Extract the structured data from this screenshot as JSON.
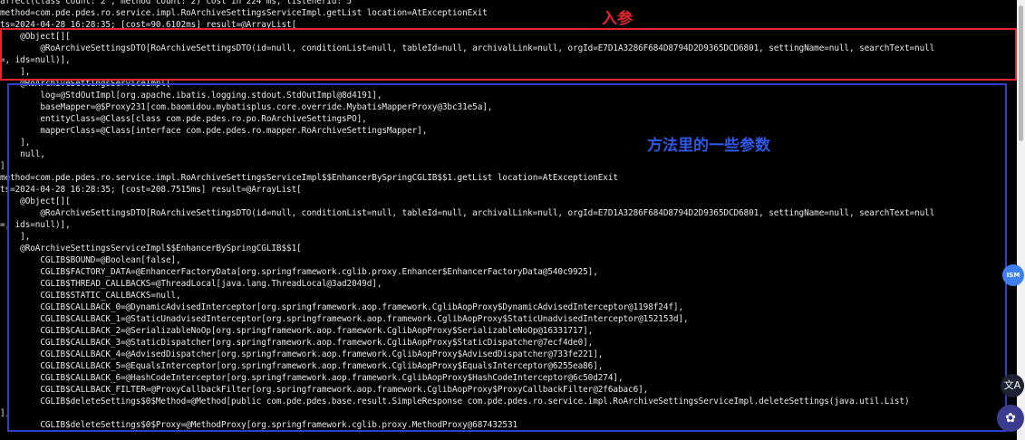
{
  "terminal": {
    "lines": [
      "affect(class count: 2 , method count: 2) cost in 224 ms, listenerId: 5",
      "method=com.pde.pdes.ro.service.impl.RoArchiveSettingsServiceImpl.getList location=AtExceptionExit",
      "ts=2024-04-28 16:28:35; [cost=90.6102ms] result=@ArrayList[",
      "    @Object[][",
      "        @RoArchiveSettingsDTO[RoArchiveSettingsDTO(id=null, conditionList=null, tableId=null, archivalLink=null, orgId=E7D1A3286F684D8794D2D9365DCD6801, settingName=null, searchText=null",
      "=, ids=null)],",
      "    ],",
      "    @RoArchiveSettingsServiceImpl[",
      "        log=@StdOutImpl[org.apache.ibatis.logging.stdout.StdOutImpl@8d4191],",
      "        baseMapper=@$Proxy231[com.baomidou.mybatisplus.core.override.MybatisMapperProxy@3bc31e5a],",
      "        entityClass=@Class[class com.pde.pdes.ro.po.RoArchiveSettingsPO],",
      "        mapperClass=@Class[interface com.pde.pdes.ro.mapper.RoArchiveSettingsMapper],",
      "    ],",
      "    null,",
      "]",
      "method=com.pde.pdes.ro.service.impl.RoArchiveSettingsServiceImpl$$EnhancerBySpringCGLIB$$1.getList location=AtExceptionExit",
      "ts=2024-04-28 16:28:35; [cost=208.7515ms] result=@ArrayList[",
      "    @Object[][",
      "        @RoArchiveSettingsDTO[RoArchiveSettingsDTO(id=null, conditionList=null, tableId=null, archivalLink=null, orgId=E7D1A3286F684D8794D2D9365DCD6801, settingName=null, searchText=null",
      "=, ids=null)],",
      "    ],",
      "    @RoArchiveSettingsServiceImpl$$EnhancerBySpringCGLIB$$1[",
      "        CGLIB$BOUND=@Boolean[false],",
      "        CGLIB$FACTORY_DATA=@EnhancerFactoryData[org.springframework.cglib.proxy.Enhancer$EnhancerFactoryData@540c9925],",
      "        CGLIB$THREAD_CALLBACKS=@ThreadLocal[java.lang.ThreadLocal@3ad2049d],",
      "        CGLIB$STATIC_CALLBACKS=null,",
      "        CGLIB$CALLBACK_0=@DynamicAdvisedInterceptor[org.springframework.aop.framework.CglibAopProxy$DynamicAdvisedInterceptor@1198f24f],",
      "        CGLIB$CALLBACK_1=@StaticUnadvisedInterceptor[org.springframework.aop.framework.CglibAopProxy$StaticUnadvisedInterceptor@152153d],",
      "        CGLIB$CALLBACK_2=@SerializableNoOp[org.springframework.aop.framework.CglibAopProxy$SerializableNoOp@16331717],",
      "        CGLIB$CALLBACK_3=@StaticDispatcher[org.springframework.aop.framework.CglibAopProxy$StaticDispatcher@7ecf4de0],",
      "        CGLIB$CALLBACK_4=@AdvisedDispatcher[org.springframework.aop.framework.CglibAopProxy$AdvisedDispatcher@733fe221],",
      "        CGLIB$CALLBACK_5=@EqualsInterceptor[org.springframework.aop.framework.CglibAopProxy$EqualsInterceptor@6255ea86],",
      "        CGLIB$CALLBACK_6=@HashCodeInterceptor[org.springframework.aop.framework.CglibAopProxy$HashCodeInterceptor@6c50d274],",
      "        CGLIB$CALLBACK_FILTER=@ProxyCallbackFilter[org.springframework.aop.framework.CglibAopProxy$ProxyCallbackFilter@2f6abac6],",
      "        CGLIB$deleteSettings$0$Method=@Method[public com.pde.pdes.base.result.SimpleResponse com.pde.pdes.ro.service.impl.RoArchiveSettingsServiceImpl.deleteSettings(java.util.List)",
      "],",
      "        CGLIB$deleteSettings$0$Proxy=@MethodProxy[org.springframework.cglib.proxy.MethodProxy@687432531"
    ]
  },
  "annotations": {
    "input_params": "入参",
    "method_params": "方法里的一些参数"
  },
  "floating": {
    "ism_label": "ISM",
    "translate_label": "文A",
    "assist_label": "✿"
  },
  "colors": {
    "input_box": "#e3262c",
    "method_box": "#2b3fd0",
    "terminal_bg": "#000000"
  }
}
